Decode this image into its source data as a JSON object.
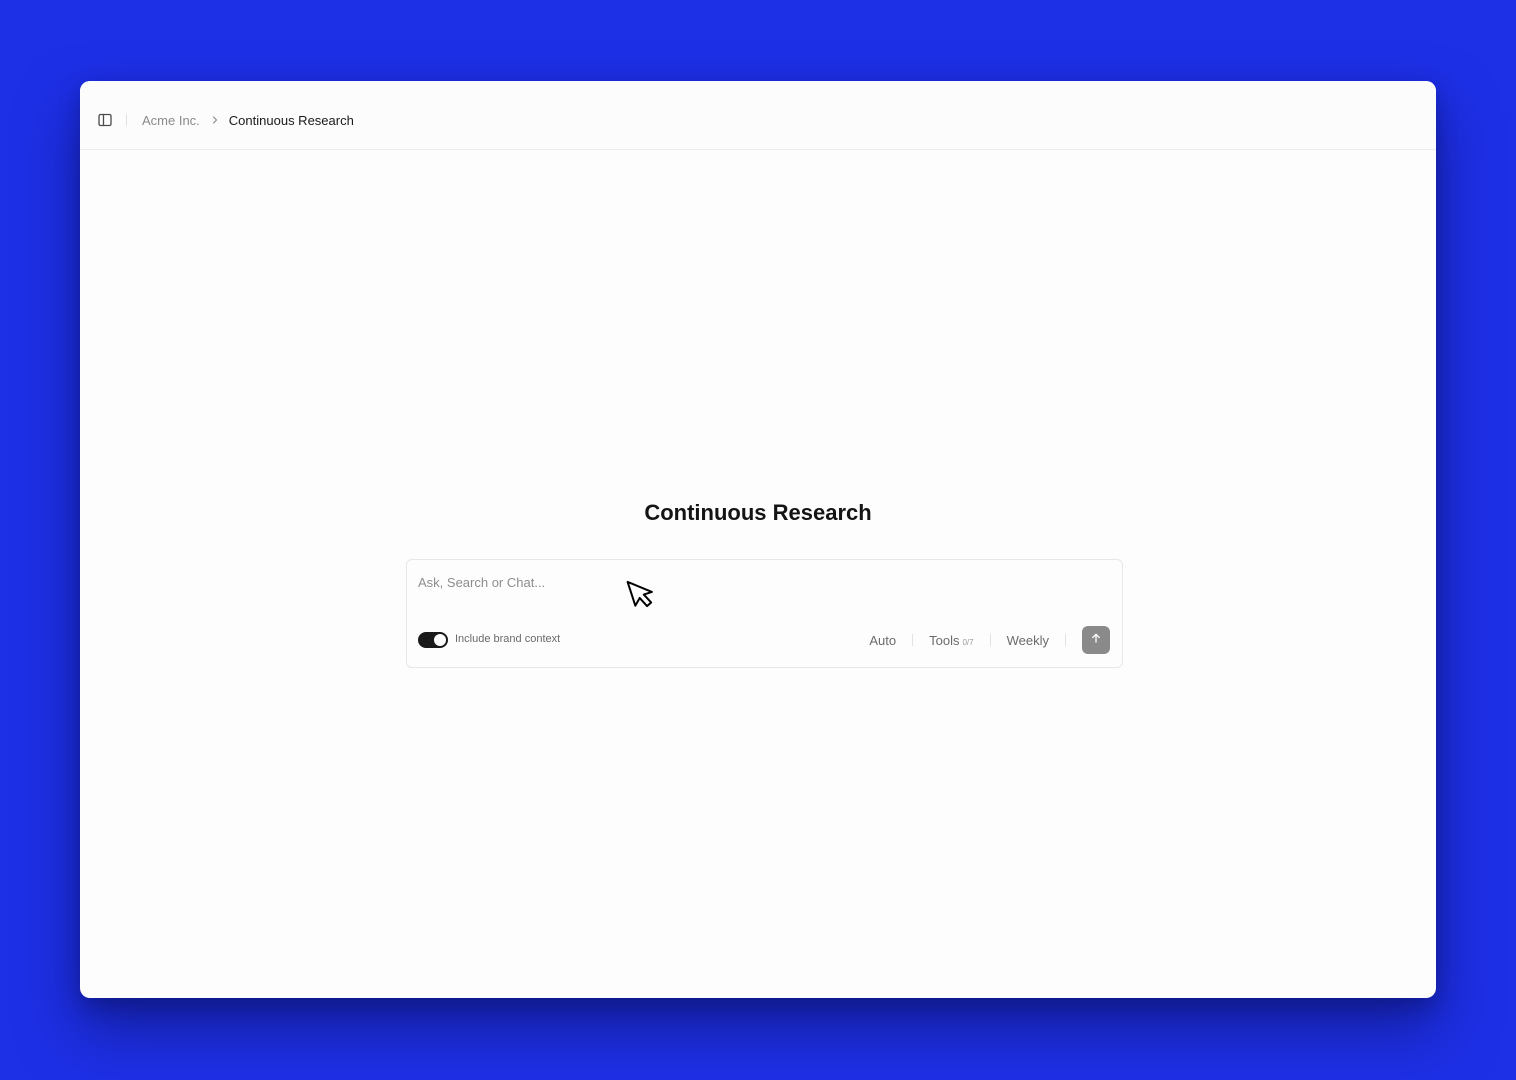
{
  "breadcrumb": {
    "root": "Acme Inc.",
    "current": "Continuous Research"
  },
  "main": {
    "title": "Continuous Research"
  },
  "composer": {
    "placeholder": "Ask, Search or Chat...",
    "value": "",
    "brand_context": {
      "label": "Include brand context",
      "enabled": true
    },
    "model": "Auto",
    "tools": {
      "label": "Tools",
      "count": "0/7"
    },
    "schedule": "Weekly"
  },
  "icons": {
    "sidebar_toggle": "sidebar-panel-icon",
    "breadcrumb_separator": "chevron-right-icon",
    "send": "arrow-up-icon",
    "cursor": "mouse-pointer-icon"
  },
  "colors": {
    "background": "#1e30e6",
    "toggle_on": "#1a1a1a",
    "send_button": "#8a8a8a"
  }
}
